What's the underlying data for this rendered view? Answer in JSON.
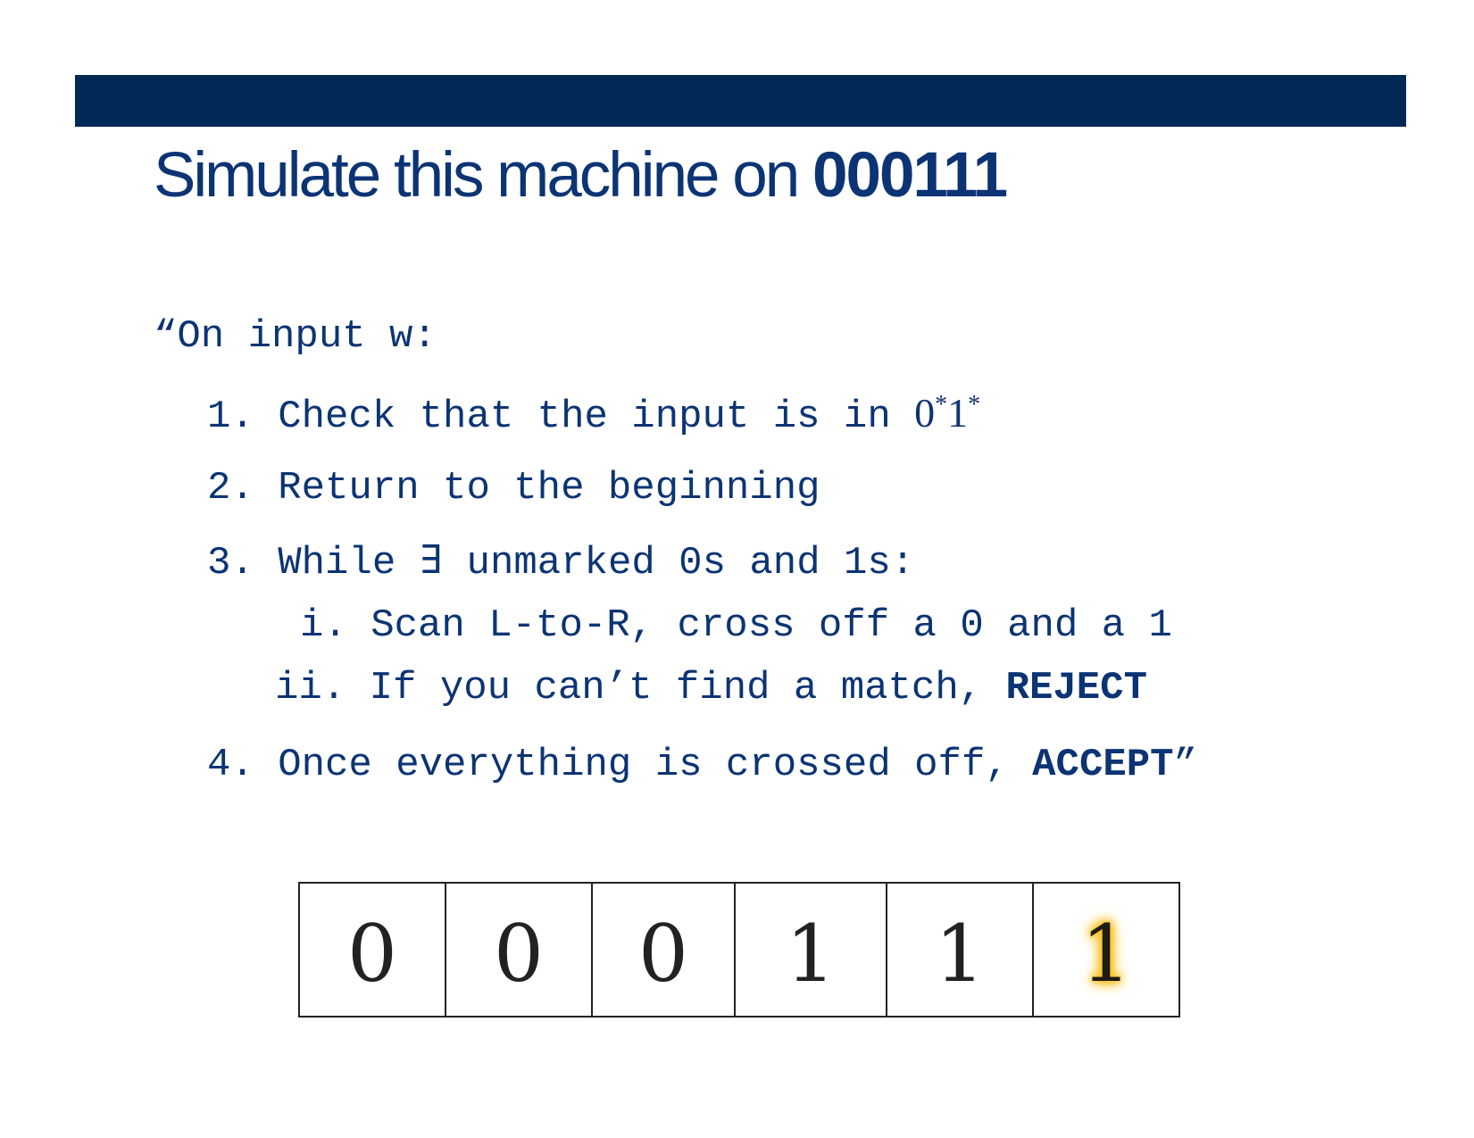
{
  "title": {
    "prefix": "Simulate this machine on ",
    "input": "000111"
  },
  "algorithm": {
    "intro": "“On input w:",
    "step1": {
      "number": "1.",
      "text": "Check that the input is in ",
      "lang_0": "0",
      "star_a": "*",
      "lang_1": "1",
      "star_b": "*"
    },
    "step2": {
      "number": "2.",
      "text": "Return to the beginning"
    },
    "step3": {
      "number": "3.",
      "text": "While ∃ unmarked 0s and 1s:"
    },
    "step3i": {
      "number": "i.",
      "text": "Scan L-to-R, cross off a 0 and a 1"
    },
    "step3ii": {
      "number": "ii.",
      "text": "If you can’t find a match, ",
      "keyword": "REJECT"
    },
    "step4": {
      "number": "4.",
      "text": "Once everything is crossed off, ",
      "keyword": "ACCEPT",
      "close_quote": "”"
    }
  },
  "tape": {
    "cells": [
      "0",
      "0",
      "0",
      "1",
      "1",
      "1"
    ],
    "highlighted_index": 5,
    "highlight_color": "#f8c21c"
  },
  "colors": {
    "bar": "#022955",
    "text": "#0c3474"
  }
}
